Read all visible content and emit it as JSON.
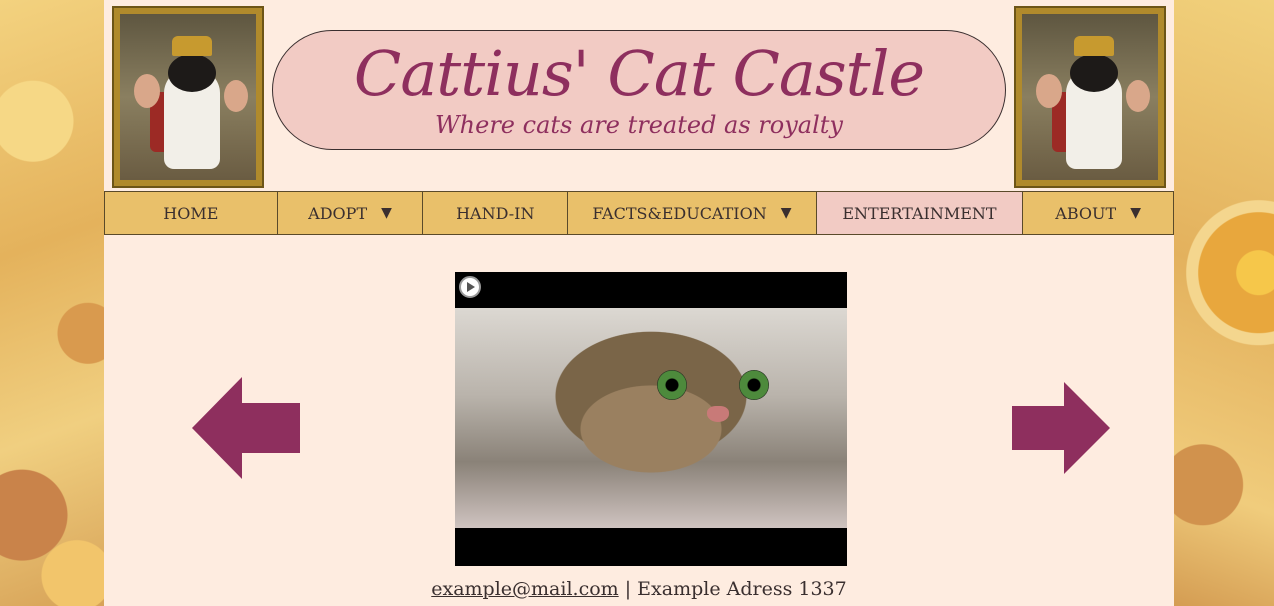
{
  "header": {
    "title": "Cattius' Cat Castle",
    "subtitle": "Where cats are treated as royalty"
  },
  "nav": {
    "items": [
      {
        "label": "HOME",
        "dropdown": false
      },
      {
        "label": "ADOPT",
        "dropdown": true
      },
      {
        "label": "HAND-IN",
        "dropdown": false
      },
      {
        "label": "FACTS&EDUCATION",
        "dropdown": true
      },
      {
        "label": "ENTERTAINMENT",
        "dropdown": false,
        "active": true
      },
      {
        "label": "ABOUT",
        "dropdown": true
      }
    ],
    "caret": "▼"
  },
  "colors": {
    "accent": "#8e2f5e",
    "nav_bg": "#e9c06a",
    "nav_active": "#f2cbc4",
    "page_bg": "#feece0"
  },
  "footer": {
    "email": "example@mail.com",
    "separator": "|",
    "address": "Example Adress 1337"
  },
  "icons": {
    "prev": "arrow-left-icon",
    "next": "arrow-right-icon",
    "play": "play-icon"
  }
}
